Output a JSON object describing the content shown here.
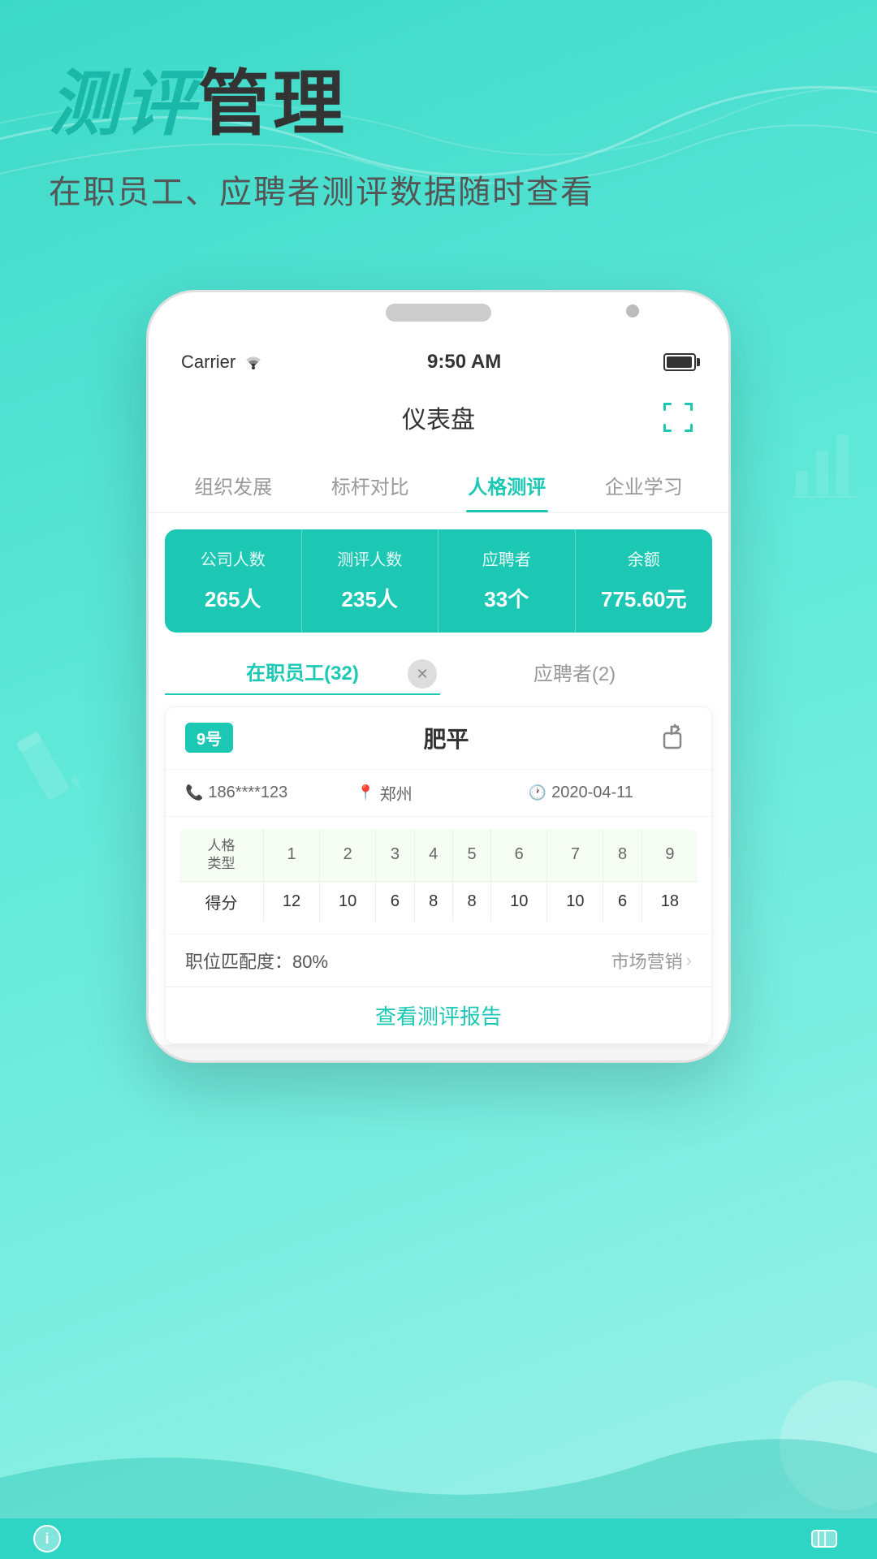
{
  "background_color": "#3dd9c8",
  "header": {
    "title_part1": "测评",
    "title_part2": "管理",
    "subtitle": "在职员工、应聘者测评数据随时查看"
  },
  "phone": {
    "carrier": "Carrier",
    "time": "9:50 AM",
    "dashboard_title": "仪表盘",
    "tabs": [
      {
        "label": "组织发展",
        "active": false
      },
      {
        "label": "标杆对比",
        "active": false
      },
      {
        "label": "人格测评",
        "active": true
      },
      {
        "label": "企业学习",
        "active": false
      }
    ],
    "stats": [
      {
        "label": "公司人数",
        "value": "265人"
      },
      {
        "label": "测评人数",
        "value": "235人"
      },
      {
        "label": "应聘者",
        "value": "33个"
      },
      {
        "label": "余额",
        "value": "775.60元"
      }
    ],
    "sub_tabs": [
      {
        "label": "在职员工(32)",
        "active": true
      },
      {
        "label": "应聘者(2)",
        "active": false
      }
    ],
    "employee_card": {
      "num_badge": "9号",
      "name": "肥平",
      "phone": "186****123",
      "location": "郑州",
      "date": "2020-04-11",
      "personality_table": {
        "row1_label": "人格\n类型",
        "row2_label": "得分",
        "columns": [
          "1",
          "2",
          "3",
          "4",
          "5",
          "6",
          "7",
          "8",
          "9"
        ],
        "scores": [
          "12",
          "10",
          "6",
          "8",
          "8",
          "10",
          "10",
          "6",
          "18"
        ]
      },
      "match_label": "职位匹配度：80%",
      "department": "市场营销",
      "view_report": "查看测评报告"
    }
  }
}
